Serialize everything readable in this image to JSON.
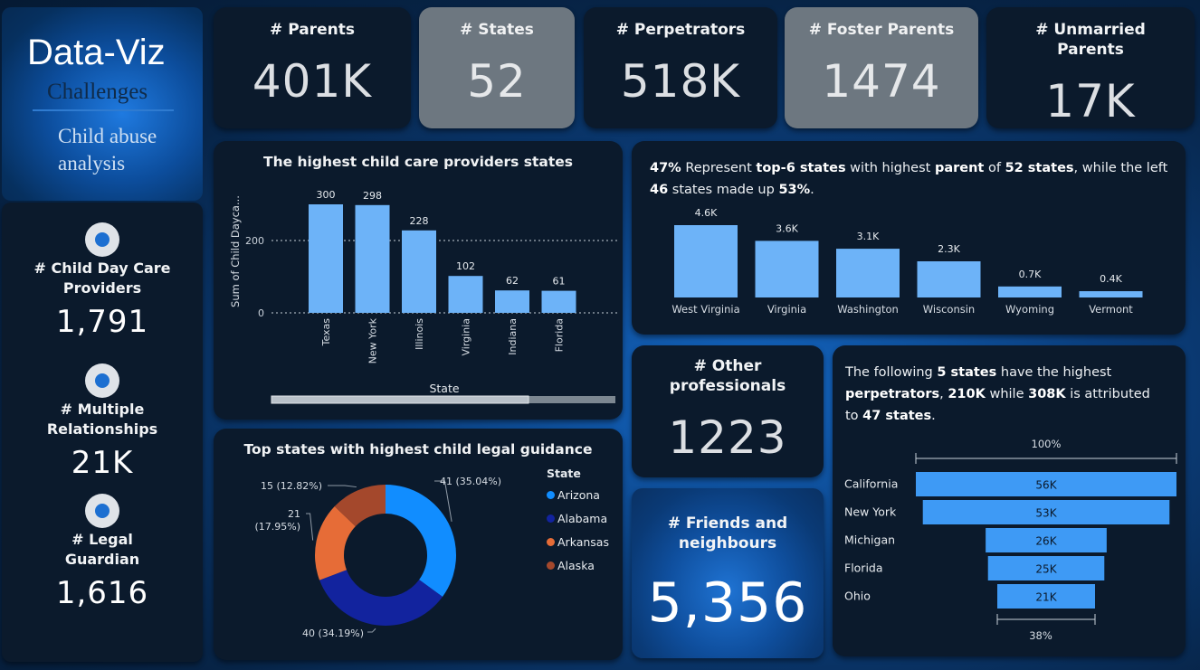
{
  "brand": {
    "title": "Data-Viz",
    "subtitle": "Challenges",
    "description": "Child abuse analysis"
  },
  "kpis_top": [
    {
      "label": "# Parents",
      "value": "401K"
    },
    {
      "label": "# States",
      "value": "52"
    },
    {
      "label": "# Perpetrators",
      "value": "518K"
    },
    {
      "label": "# Foster Parents",
      "value": "1474"
    },
    {
      "label": "# Unmarried Parents",
      "value": "17K"
    }
  ],
  "kpis_left": [
    {
      "label": "# Child Day Care Providers",
      "value": "1,791"
    },
    {
      "label": "# Multiple Relationships",
      "value": "21K"
    },
    {
      "label": "# Legal Guardian",
      "value": "1,616"
    }
  ],
  "other_professionals": {
    "label": "# Other professionals",
    "value": "1223"
  },
  "friends_neighbours": {
    "label": "# Friends and neighbours",
    "value": "5,356"
  },
  "colors": {
    "bar": "#6db3f8",
    "arizona": "#118dff",
    "alabama": "#12239e",
    "arkansas": "#e66c37",
    "alaska": "#a4482c",
    "panel": "#0b1a2c",
    "grey_panel": "#6d7780"
  },
  "parents_text": {
    "p1": "47%",
    "p2": " Represent ",
    "p3": "top-6 states",
    "p4": " with highest ",
    "p5": "parent",
    "p6": " of ",
    "p7": "52 states",
    "p8": ", while the left ",
    "p9": "46",
    "p10": " states made up ",
    "p11": "53%",
    "p12": "."
  },
  "perp_text": {
    "p1": "The following ",
    "p2": "5 states",
    "p3": " have the highest ",
    "p4": "perpetrators",
    "p5": ", ",
    "p6": "210K",
    "p7": " while ",
    "p8": "308K",
    "p9": " is attributed to ",
    "p10": "47 states",
    "p11": "."
  },
  "chart_data": [
    {
      "type": "bar",
      "title": "The highest child care providers states",
      "xlabel": "State",
      "ylabel": "Sum of Child Dayca...",
      "categories": [
        "Texas",
        "New York",
        "Illinois",
        "Virginia",
        "Indiana",
        "Florida"
      ],
      "values": [
        300,
        298,
        228,
        102,
        62,
        61
      ],
      "data_labels": [
        "300",
        "298",
        "228",
        "102",
        "62",
        "61"
      ],
      "yticks": [
        "0",
        "200"
      ],
      "ylim": [
        0,
        340
      ],
      "grid": true
    },
    {
      "type": "bar",
      "title": "",
      "categories": [
        "West Virginia",
        "Virginia",
        "Washington",
        "Wisconsin",
        "Wyoming",
        "Vermont"
      ],
      "values": [
        4600,
        3600,
        3100,
        2300,
        700,
        400
      ],
      "data_labels": [
        "4.6K",
        "3.6K",
        "3.1K",
        "2.3K",
        "0.7K",
        "0.4K"
      ],
      "ylim": [
        0,
        4600
      ]
    },
    {
      "type": "pie",
      "subtype": "donut",
      "title": "Top states with highest child legal guidance",
      "legend_title": "State",
      "legend_position": "right",
      "categories": [
        "Arizona",
        "Alabama",
        "Arkansas",
        "Alaska"
      ],
      "values": [
        41,
        40,
        21,
        15
      ],
      "data_labels": [
        "41 (35.04%)",
        "40 (34.19%)",
        "21 (17.95%)",
        "15 (12.82%)"
      ]
    },
    {
      "type": "bar",
      "subtype": "funnel",
      "title": "",
      "categories": [
        "California",
        "New York",
        "Michigan",
        "Florida",
        "Ohio"
      ],
      "values": [
        56000,
        53000,
        26000,
        25000,
        21000
      ],
      "data_labels": [
        "56K",
        "53K",
        "26K",
        "25K",
        "21K"
      ],
      "top_label": "100%",
      "bottom_label": "38%"
    }
  ]
}
